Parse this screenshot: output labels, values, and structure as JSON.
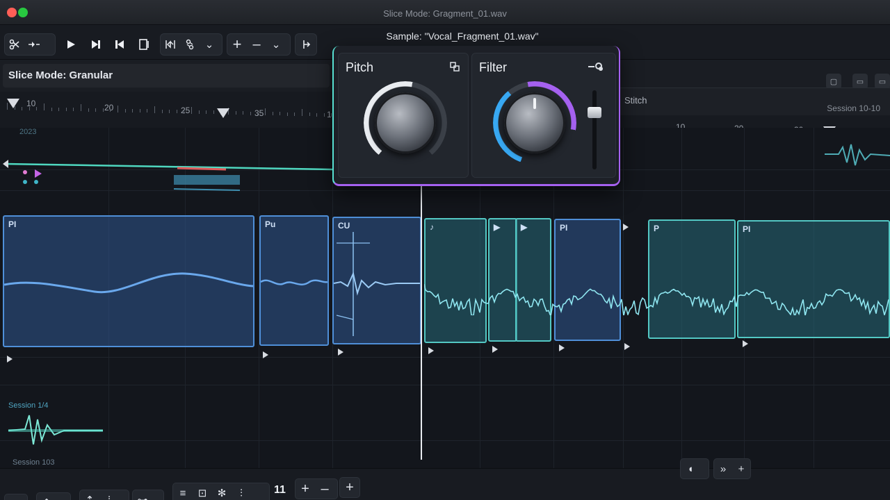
{
  "window": {
    "title": "Slice Mode: Gragment_01.wav"
  },
  "toolbar": {
    "sample_label": "Sample: \"Vocal_Fragment_01.wav\"",
    "icons": [
      "scissors-icon",
      "split-icon",
      "play-icon",
      "skip-forward-icon",
      "skip-back-icon",
      "slice-icon",
      "snap-icon",
      "link-icon",
      "chevron-down-icon",
      "plus-icon",
      "minus-icon",
      "chevron-down-icon",
      "route-icon"
    ],
    "plus": "+",
    "minus": "–",
    "chev": "⌄"
  },
  "mode": {
    "label": "Slice Mode: Granular",
    "right_label": "Stitch",
    "right_session": "Session 10-10"
  },
  "ruler": {
    "ticks": [
      "10",
      "20",
      "25",
      "35",
      "1"
    ],
    "right_ticks": [
      "10",
      "20",
      "30"
    ]
  },
  "overview": {
    "year": "2023"
  },
  "popup": {
    "pitch": {
      "title": "Pitch"
    },
    "filter": {
      "title": "Filter"
    }
  },
  "clips": [
    {
      "label": "PI"
    },
    {
      "label": "Pu"
    },
    {
      "label": "CU"
    },
    {
      "label": "♪"
    },
    {
      "label": "▶"
    },
    {
      "label": "▶"
    },
    {
      "label": "PI"
    },
    {
      "label": "P"
    },
    {
      "label": "PI"
    }
  ],
  "thumb": {
    "title": "Session 1/4",
    "session": "Session 103"
  },
  "bottom": {
    "count": "11",
    "plus": "+",
    "minus": "–"
  },
  "colors": {
    "accent_blue": "#4f8fd8",
    "accent_teal": "#53c8c4",
    "accent_purple": "#a561f0"
  }
}
